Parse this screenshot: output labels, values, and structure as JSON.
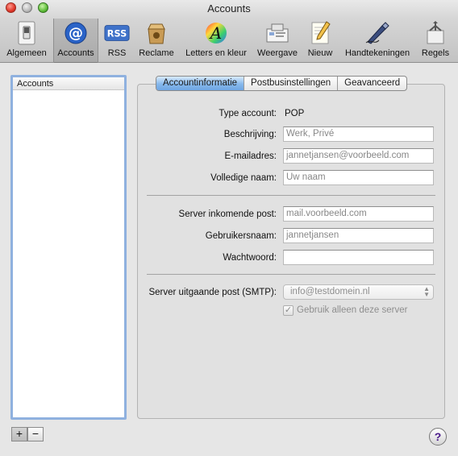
{
  "window": {
    "title": "Accounts"
  },
  "toolbar": {
    "items": [
      {
        "label": "Algemeen",
        "icon": "light-switch-icon"
      },
      {
        "label": "Accounts",
        "icon": "at-sign-icon",
        "selected": true
      },
      {
        "label": "RSS",
        "icon": "rss-icon"
      },
      {
        "label": "Reclame",
        "icon": "junk-bag-icon"
      },
      {
        "label": "Letters en kleur",
        "icon": "font-color-icon"
      },
      {
        "label": "Weergave",
        "icon": "viewing-icon"
      },
      {
        "label": "Nieuw",
        "icon": "compose-icon"
      },
      {
        "label": "Handtekeningen",
        "icon": "signature-pen-icon"
      },
      {
        "label": "Regels",
        "icon": "rules-icon"
      }
    ]
  },
  "sidebar": {
    "header": "Accounts",
    "add_label": "+",
    "remove_label": "−"
  },
  "tabs": [
    "Accountinformatie",
    "Postbusinstellingen",
    "Geavanceerd"
  ],
  "form": {
    "type_label": "Type account:",
    "type_value": "POP",
    "description_label": "Beschrijving:",
    "description_placeholder": "Werk, Privé",
    "email_label": "E-mailadres:",
    "email_placeholder": "jannetjansen@voorbeeld.com",
    "fullname_label": "Volledige naam:",
    "fullname_placeholder": "Uw naam",
    "incoming_label": "Server inkomende post:",
    "incoming_placeholder": "mail.voorbeeld.com",
    "username_label": "Gebruikersnaam:",
    "username_placeholder": "jannetjansen",
    "password_label": "Wachtwoord:",
    "password_value": "",
    "smtp_label": "Server uitgaande post (SMTP):",
    "smtp_value": "info@testdomein.nl",
    "only_server_label": "Gebruik alleen deze server",
    "only_server_checked": true
  },
  "help": {
    "label": "?"
  }
}
